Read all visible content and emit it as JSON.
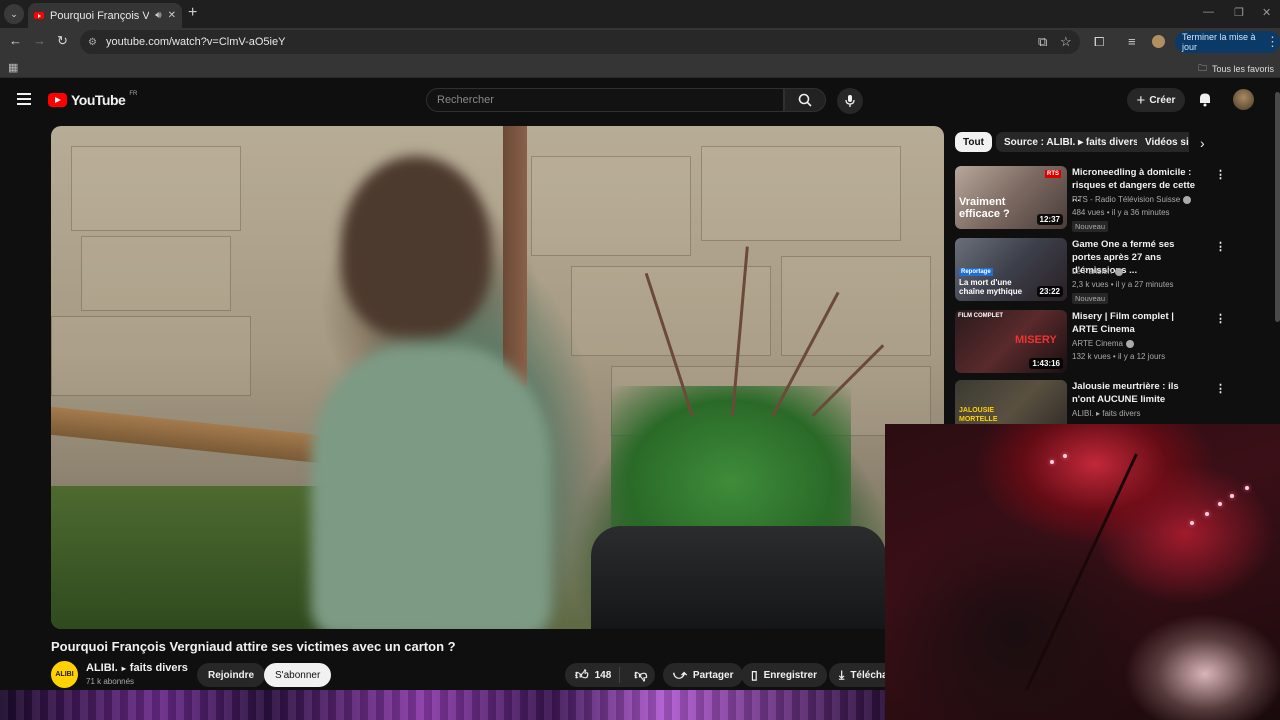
{
  "browser": {
    "tab_title": "Pourquoi François Vergniaud",
    "url": "youtube.com/watch?v=ClmV-aO5ieY",
    "update_label": "Terminer la mise à jour",
    "bookmarks_label": "Tous les favoris"
  },
  "youtube": {
    "logo_text": "YouTube",
    "country": "FR",
    "search_placeholder": "Rechercher",
    "create_label": "Créer"
  },
  "video": {
    "title": "Pourquoi François Vergniaud attire ses victimes avec un carton ?",
    "channel": "ALIBI.",
    "playlist": "faits divers",
    "channel_avatar_text": "ALIBI",
    "subscribers": "71 k abonnés",
    "join_label": "Rejoindre",
    "subscribe_label": "S'abonner",
    "likes": "148",
    "share_label": "Partager",
    "save_label": "Enregistrer",
    "download_label": "Téléchar"
  },
  "chips": [
    "Tout",
    "Source : ALIBI. ▸ faits divers",
    "Vidéos sim"
  ],
  "recommendations": [
    {
      "title": "Microneedling à domicile : risques et dangers de cette ...",
      "channel": "RTS - Radio Télévision Suisse",
      "meta": "484 vues • il y a 36 minutes",
      "badge": "Nouveau",
      "duration": "12:37",
      "thumb_text": "Vraiment efficace ?",
      "thumb_tag": "RTS"
    },
    {
      "title": "Game One a fermé ses portes après 27 ans d'émissions ...",
      "channel": "Le Parisien",
      "meta": "2,3 k vues • il y a 27 minutes",
      "badge": "Nouveau",
      "duration": "23:22",
      "thumb_text": "La mort d'une chaîne mythique",
      "thumb_tag": "Reportage"
    },
    {
      "title": "Misery | Film complet | ARTE Cinema",
      "channel": "ARTE Cinema",
      "meta": "132 k vues • il y a 12 jours",
      "badge": "",
      "duration": "1:43:16",
      "thumb_text": "MISERY",
      "thumb_tag": "FILM COMPLET"
    },
    {
      "title": "Jalousie meurtrière  : ils n'ont AUCUNE limite",
      "channel": "ALIBI. ▸ faits divers",
      "meta": "",
      "badge": "",
      "duration": "",
      "thumb_text": "JALOUSIE MORTELLE",
      "thumb_tag": ""
    }
  ]
}
